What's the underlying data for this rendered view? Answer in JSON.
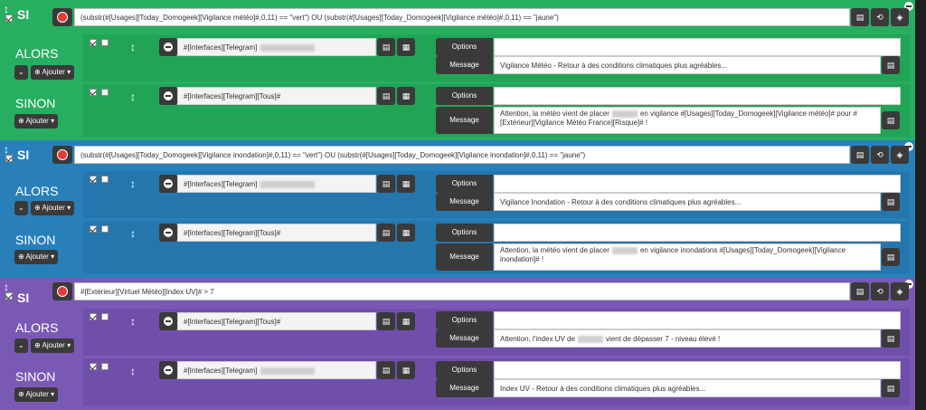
{
  "labels": {
    "si": "SI",
    "alors": "ALORS",
    "sinon": "SINON",
    "ajouter": "Ajouter",
    "options": "Options",
    "message": "Message"
  },
  "blocks": [
    {
      "color": "#27ae60",
      "sub": "#22a456",
      "condition": "(substr(#[Usages][Today_Domogeek][Vigilance météo]#,0,11) == \"vert\") OU (substr(#[Usages][Today_Domogeek][Vigilance météo]#,0,11) == \"jaune\")",
      "alors": {
        "cmd": "#[Interfaces][Telegram]",
        "message": "Vigilance Météo - Retour à des conditions climatiques plus agréables..."
      },
      "sinon": {
        "cmd": "#[Interfaces][Telegram][Tous]#",
        "message_a": "Attention, la météo vient de placer",
        "message_b": "en vigilance #[Usages][Today_Domogeek][Vigilance météo]# pour #[Extérieur][Vigilance Météo France][Risque]# !"
      }
    },
    {
      "color": "#2980b9",
      "sub": "#2476ad",
      "condition": "(substr(#[Usages][Today_Domogeek][Vigilance inondation]#,0,11) == \"vert\") OU (substr(#[Usages][Today_Domogeek][Vigilance inondation]#,0,11) == \"jaune\")",
      "alors": {
        "cmd": "#[Interfaces][Telegram]",
        "message": "Vigilance Inondation - Retour à des conditions climatiques plus agréables..."
      },
      "sinon": {
        "cmd": "#[Interfaces][Telegram][Tous]#",
        "message_a": "Attention, la météo vient de placer",
        "message_b": "en vigilance inondations #[Usages][Today_Domogeek][Vigilance inondation]# !"
      }
    },
    {
      "color": "#7a59b5",
      "sub": "#6f4faa",
      "condition": "#[Extérieur][Virtuel Météo][Index UV]# > 7",
      "alors": {
        "cmd": "#[Interfaces][Telegram][Tous]#",
        "message_a": "Attention, l'index UV de",
        "message_b": "vient de dépasser 7  - niveau élevé !"
      },
      "sinon": {
        "cmd": "#[Interfaces][Telegram]",
        "message": "Index UV - Retour à des conditions climatiques plus agréables..."
      }
    }
  ]
}
